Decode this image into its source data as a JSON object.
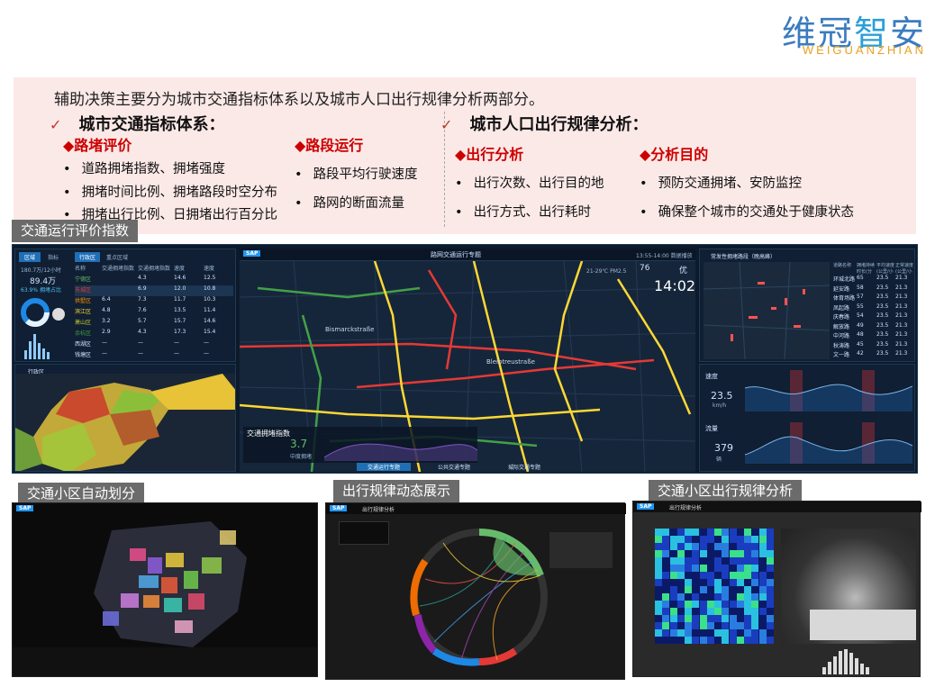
{
  "logo": {
    "cn": [
      "维",
      "冠",
      "智",
      "安"
    ],
    "en": "WEIGUANZHIAN"
  },
  "intro": "辅助决策主要分为城市交通指标体系以及城市人口出行规律分析两部分。",
  "left_section": {
    "check": "✓",
    "title": "城市交通指标体系：",
    "groups": [
      {
        "title": "◆路堵评价",
        "items": [
          "道路拥堵指数、拥堵强度",
          "拥堵时间比例、拥堵路段时空分布",
          "拥堵出行比例、日拥堵出行百分比"
        ]
      },
      {
        "title": "◆路段运行",
        "items": [
          "路段平均行驶速度",
          "路网的断面流量"
        ]
      }
    ]
  },
  "right_section": {
    "check": "✓",
    "title": "城市人口出行规律分析：",
    "groups": [
      {
        "title": "◆出行分析",
        "items": [
          "出行次数、出行目的地",
          "出行方式、出行耗时"
        ]
      },
      {
        "title": "◆分析目的",
        "items": [
          "预防交通拥堵、安防监控",
          "确保整个城市的交通处于健康状态"
        ]
      }
    ]
  },
  "labels": {
    "eval": "交通运行评价指数",
    "division": "交通小区自动划分",
    "dynamic": "出行规律动态展示",
    "analysis": "交通小区出行规律分析"
  },
  "dashboard": {
    "title": "路网交通运行专题",
    "time_range": "13:55-14:00 数据播放",
    "clock": "14:02",
    "weather": "21-29℃  PM2.5",
    "aqi": "76",
    "aqi_level": "优",
    "left_tabs": [
      "区域",
      "指标"
    ],
    "stat_value": "89.4万",
    "stat_sub": "180.7万/12小时",
    "stat_pct": "63.9% 拥堵占比",
    "table_tabs": [
      "行政区",
      "重点区域"
    ],
    "table_headers": [
      "名称",
      "交通拥堵指数",
      "交通拥堵指数",
      "速度",
      "速度"
    ],
    "table_rows": [
      [
        "宁德区",
        "",
        "4.3",
        "14.6",
        "12.5"
      ],
      [
        "东城区",
        "",
        "6.9",
        "12.0",
        "10.8"
      ],
      [
        "拱墅区",
        "6.4",
        "7.3",
        "11.7",
        "10.3"
      ],
      [
        "滨江区",
        "4.8",
        "7.6",
        "13.5",
        "11.4"
      ],
      [
        "萧山区",
        "3.2",
        "5.7",
        "15.7",
        "14.6"
      ],
      [
        "余杭区",
        "2.9",
        "4.3",
        "17.3",
        "15.4"
      ],
      [
        "西湖区",
        "—",
        "—",
        "—",
        "—"
      ],
      [
        "钱塘区",
        "—",
        "—",
        "—",
        "—"
      ]
    ],
    "district_label": "行政区",
    "congestion_label": "交通拥堵指数",
    "congestion_value": "3.7",
    "congestion_sub": "中度拥堵",
    "bottom_tabs": [
      "交通运行专题",
      "公共交通专题",
      "城际交通专题"
    ],
    "right_title": "常发性拥堵路段（晚高峰）",
    "right_headers": [
      "道路名称",
      "拥堵持续时长(分钟)",
      "平均速度(公里/小时)",
      "正常速度(公里/小时)"
    ],
    "right_rows": [
      [
        "环城北路",
        "65",
        "23.5",
        "21.3"
      ],
      [
        "延安路",
        "58",
        "23.5",
        "21.3"
      ],
      [
        "体育场路",
        "57",
        "23.5",
        "21.3"
      ],
      [
        "凤起路",
        "55",
        "23.5",
        "21.3"
      ],
      [
        "庆春路",
        "54",
        "23.5",
        "21.3"
      ],
      [
        "解放路",
        "49",
        "23.5",
        "21.3"
      ],
      [
        "中河路",
        "48",
        "23.5",
        "21.3"
      ],
      [
        "秋涛路",
        "45",
        "23.5",
        "21.3"
      ],
      [
        "文一路",
        "42",
        "23.5",
        "21.3"
      ]
    ],
    "speed_label": "速度",
    "speed_value": "23.5",
    "speed_unit": "km/h",
    "flow_label": "流量",
    "flow_value": "379",
    "flow_unit": "辆",
    "street_1": "Bismarckstraße",
    "street_2": "Bleibtreustraße",
    "sap": "SAP"
  },
  "screens": {
    "dynamic_title": "出行规律分析",
    "analysis_title": "出行规律分析"
  }
}
